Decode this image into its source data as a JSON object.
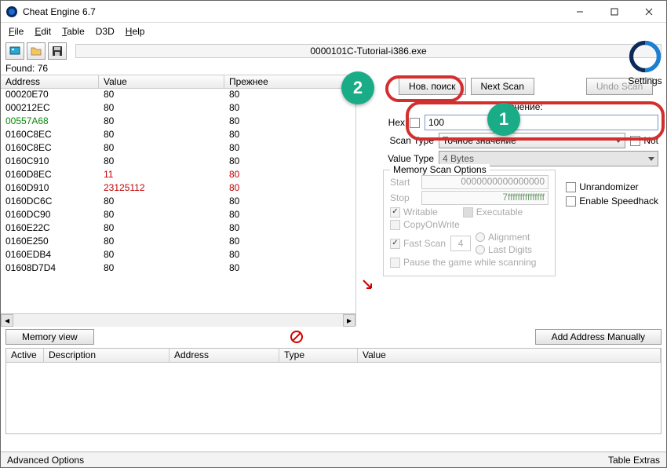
{
  "window": {
    "title": "Cheat Engine 6.7"
  },
  "menu": {
    "file": "File",
    "edit": "Edit",
    "table": "Table",
    "d3d": "D3D",
    "help": "Help"
  },
  "process": "0000101C-Tutorial-i386.exe",
  "found": "Found: 76",
  "columns": {
    "address": "Address",
    "value": "Value",
    "prev": "Прежнее"
  },
  "rows": [
    {
      "a": "00020E70",
      "v": "80",
      "p": "80"
    },
    {
      "a": "000212EC",
      "v": "80",
      "p": "80"
    },
    {
      "a": "00557A68",
      "v": "80",
      "p": "80",
      "green": true
    },
    {
      "a": "0160C8EC",
      "v": "80",
      "p": "80"
    },
    {
      "a": "0160C8EC",
      "v": "80",
      "p": "80"
    },
    {
      "a": "0160C910",
      "v": "80",
      "p": "80"
    },
    {
      "a": "0160D8EC",
      "v": "11",
      "p": "80",
      "red": true
    },
    {
      "a": "0160D910",
      "v": "23125112",
      "p": "80",
      "red": true
    },
    {
      "a": "0160DC6C",
      "v": "80",
      "p": "80"
    },
    {
      "a": "0160DC90",
      "v": "80",
      "p": "80"
    },
    {
      "a": "0160E22C",
      "v": "80",
      "p": "80"
    },
    {
      "a": "0160E250",
      "v": "80",
      "p": "80"
    },
    {
      "a": "0160EDB4",
      "v": "80",
      "p": "80"
    },
    {
      "a": "01608D7D4",
      "v": "80",
      "p": "80"
    }
  ],
  "scan": {
    "new_scan": "Нов. поиск",
    "next_scan": "Next Scan",
    "undo_scan": "Undo Scan",
    "value_label": "Значение:",
    "hex": "Hex",
    "value": "100",
    "scan_type_label": "Scan Type",
    "scan_type": "Точное значение",
    "not": "Not",
    "value_type_label": "Value Type",
    "value_type": "4 Bytes",
    "mem_legend": "Memory Scan Options",
    "start": "Start",
    "start_val": "0000000000000000",
    "stop": "Stop",
    "stop_val": "7fffffffffffffff",
    "writable": "Writable",
    "executable": "Executable",
    "cow": "CopyOnWrite",
    "fast": "Fast Scan",
    "fast_val": "4",
    "alignment": "Alignment",
    "last_digits": "Last Digits",
    "pause": "Pause the game while scanning",
    "unrandomizer": "Unrandomizer",
    "speedhack": "Enable Speedhack"
  },
  "logo_caption": "Settings",
  "under": {
    "memory_view": "Memory view",
    "add_manual": "Add Address Manually"
  },
  "table_cols": {
    "active": "Active",
    "description": "Description",
    "address": "Address",
    "type": "Type",
    "value": "Value"
  },
  "status": {
    "left": "Advanced Options",
    "right": "Table Extras"
  },
  "callouts": {
    "c1": "1",
    "c2": "2"
  }
}
